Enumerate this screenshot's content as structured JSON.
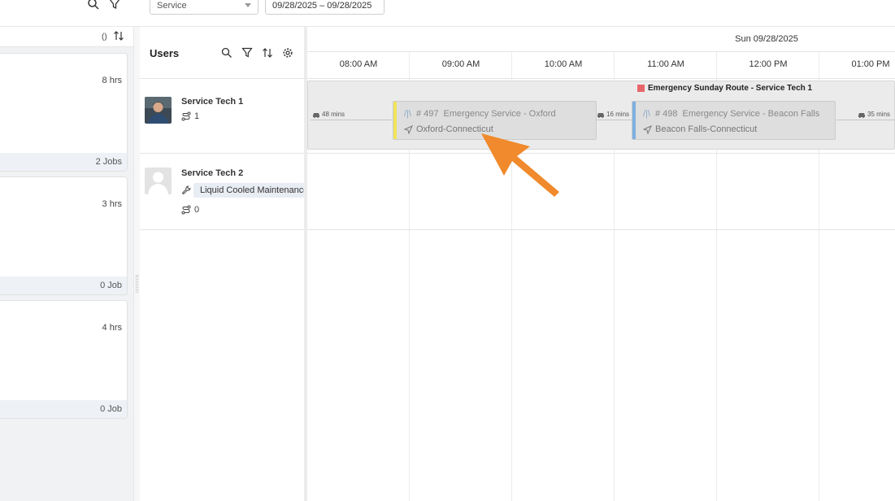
{
  "filters": {
    "type_value": "Service",
    "date_range": "09/28/2025 – 09/28/2025"
  },
  "left_panel": {
    "header_paren": "()",
    "cards": [
      {
        "hours": "8 hrs",
        "jobs": "2 Jobs"
      },
      {
        "hours": "3 hrs",
        "jobs": "0 Job"
      },
      {
        "hours": "4 hrs",
        "jobs": "0 Job"
      }
    ]
  },
  "users_panel": {
    "title": "Users",
    "users": [
      {
        "name": "Service Tech 1",
        "routes_count": "1",
        "skill": ""
      },
      {
        "name": "Service Tech 2",
        "routes_count": "0",
        "skill": "Liquid Cooled Maintenance"
      }
    ]
  },
  "timeline": {
    "date": "Sun 09/28/2025",
    "hours": [
      "08:00 AM",
      "09:00 AM",
      "10:00 AM",
      "11:00 AM",
      "12:00 PM",
      "01:00 PM"
    ],
    "route": {
      "name": "Emergency Sunday Route - Service Tech 1",
      "color": "#e8666a",
      "travel_times": [
        "48 mins",
        "16 mins",
        "35 mins"
      ],
      "jobs": [
        {
          "id": "# 497",
          "title": "Emergency Service - Oxford",
          "location": "Oxford-Connecticut",
          "stripe_color": "#f1e45a"
        },
        {
          "id": "# 498",
          "title": "Emergency Service - Beacon Falls",
          "location": "Beacon Falls-Connecticut",
          "stripe_color": "#7fb0e0"
        }
      ]
    }
  },
  "colors": {
    "annotation_arrow": "#f08a2c"
  }
}
